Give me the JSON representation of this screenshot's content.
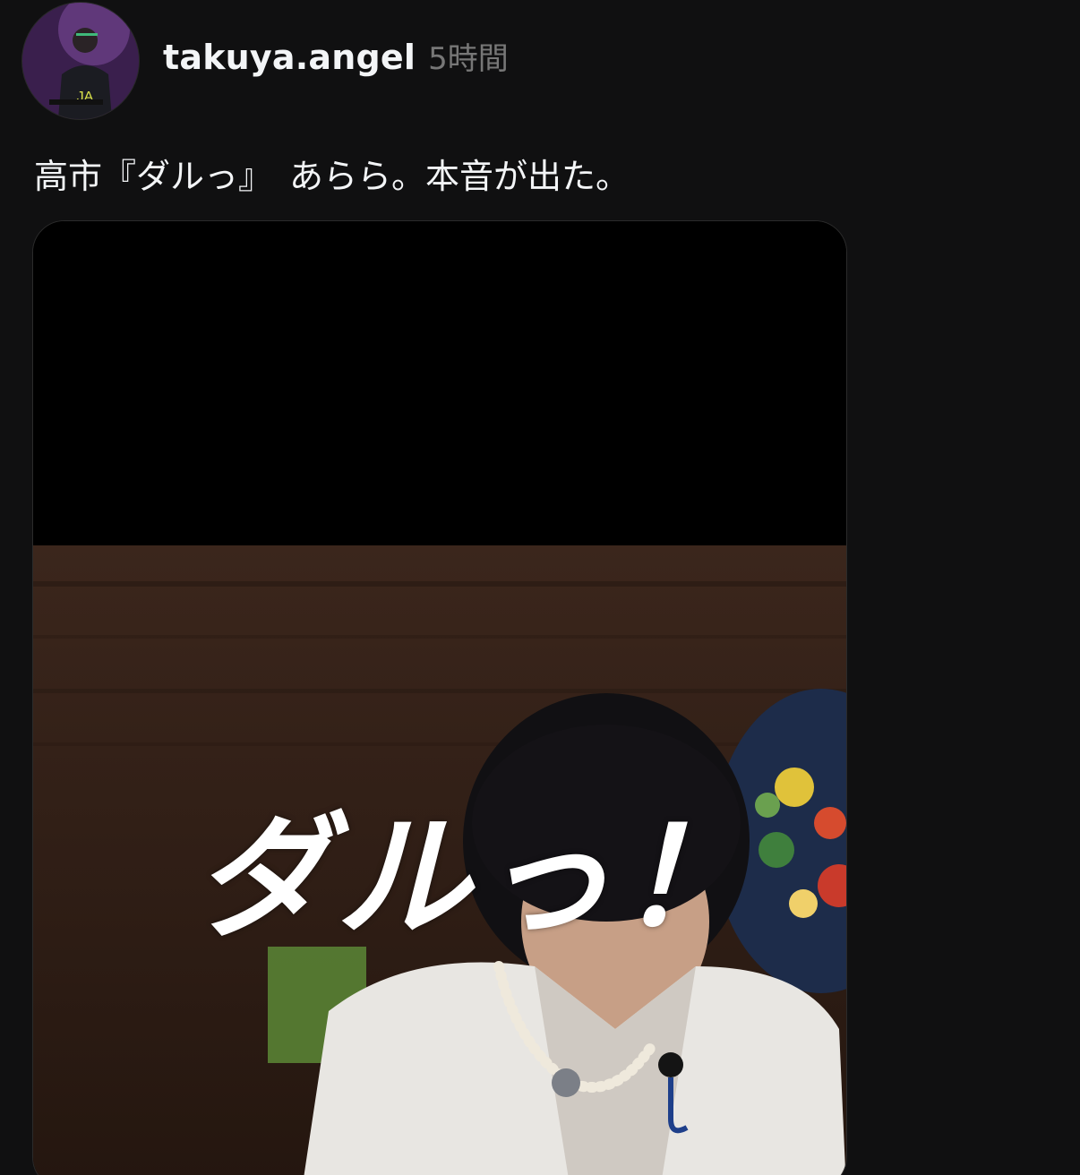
{
  "post": {
    "username": "takuya.angel",
    "timestamp": "5時間",
    "caption": "高市『ダルっ』　あらら。本音が出た。",
    "avatar_icon": "user-avatar",
    "media": {
      "overlay_text": "ダルっ！"
    }
  }
}
